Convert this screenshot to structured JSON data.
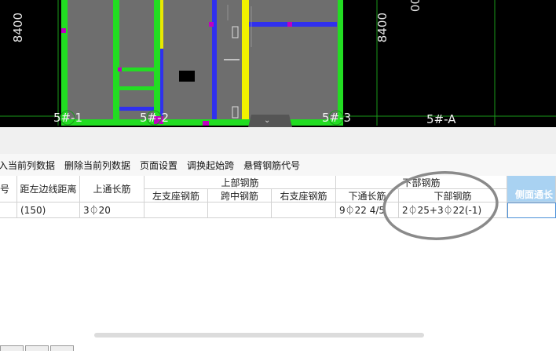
{
  "cad": {
    "dims": [
      "8400",
      "8400",
      "00"
    ],
    "axes": [
      "5#-1",
      "5#-2",
      "5#-3",
      "5#-A"
    ],
    "collapse_icon": "chevron-down-icon"
  },
  "toolbar": {
    "items": [
      "入当前列数据",
      "删除当前列数据",
      "页面设置",
      "调换起始跨",
      "悬臂钢筋代号"
    ]
  },
  "grid": {
    "h": {
      "col0": "号",
      "dist": "距左边线距离",
      "top_through": "上通长筋",
      "top_group": "上部钢筋",
      "left_seat": "左支座钢筋",
      "mid": "跨中钢筋",
      "right_seat": "右支座钢筋",
      "bottom_group": "下部钢筋",
      "bottom_through": "下通长筋",
      "bottom_bar": "下部钢筋",
      "side": "侧面通长"
    },
    "row": {
      "dist": "(150)",
      "top_through": "3⏀20",
      "bottom_through": "9⏀22 4/5",
      "bottom_bar": "2⏀25+3⏀22(-1)"
    }
  },
  "colors": {
    "grid_highlight": "#cfe5f7",
    "cad_bg": "#000000"
  }
}
